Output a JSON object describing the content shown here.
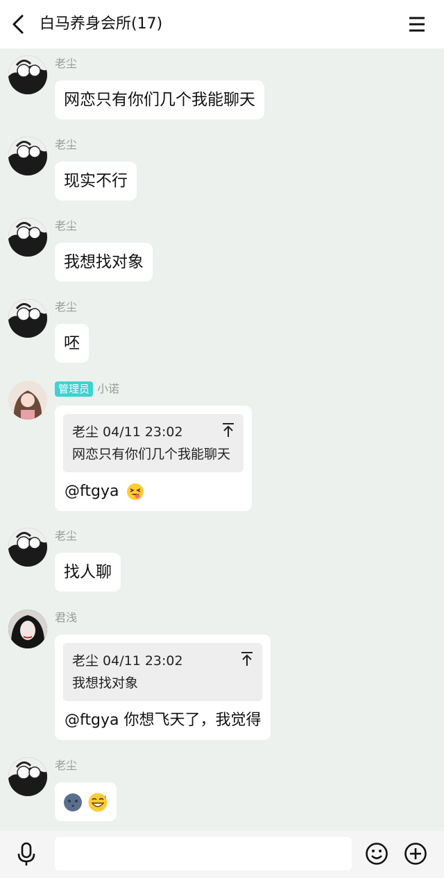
{
  "header": {
    "title": "白马养身会所(17)"
  },
  "messages": [
    {
      "sender": "老尘",
      "text": "网恋只有你们几个我能聊天"
    },
    {
      "sender": "老尘",
      "text": "现实不行"
    },
    {
      "sender": "老尘",
      "text": "我想找对象"
    },
    {
      "sender": "老尘",
      "text": "呸"
    },
    {
      "badge": "管理员",
      "sender": "小诺",
      "quote_header": "老尘 04/11 23:02",
      "quote_text": "网恋只有你们几个我能聊天",
      "text": "@ftgya"
    },
    {
      "sender": "老尘",
      "text": "找人聊"
    },
    {
      "sender": "君浅",
      "quote_header": "老尘 04/11 23:02",
      "quote_text": "我想找对象",
      "text": "@ftgya 你想飞天了，我觉得"
    },
    {
      "sender": "老尘",
      "emojis": [
        "new-moon-face-emoji",
        "grinning-sweat-emoji"
      ]
    }
  ],
  "input": {
    "placeholder": ""
  },
  "colors": {
    "background": "#ecf1ee",
    "badge": "#3fd2d0"
  }
}
